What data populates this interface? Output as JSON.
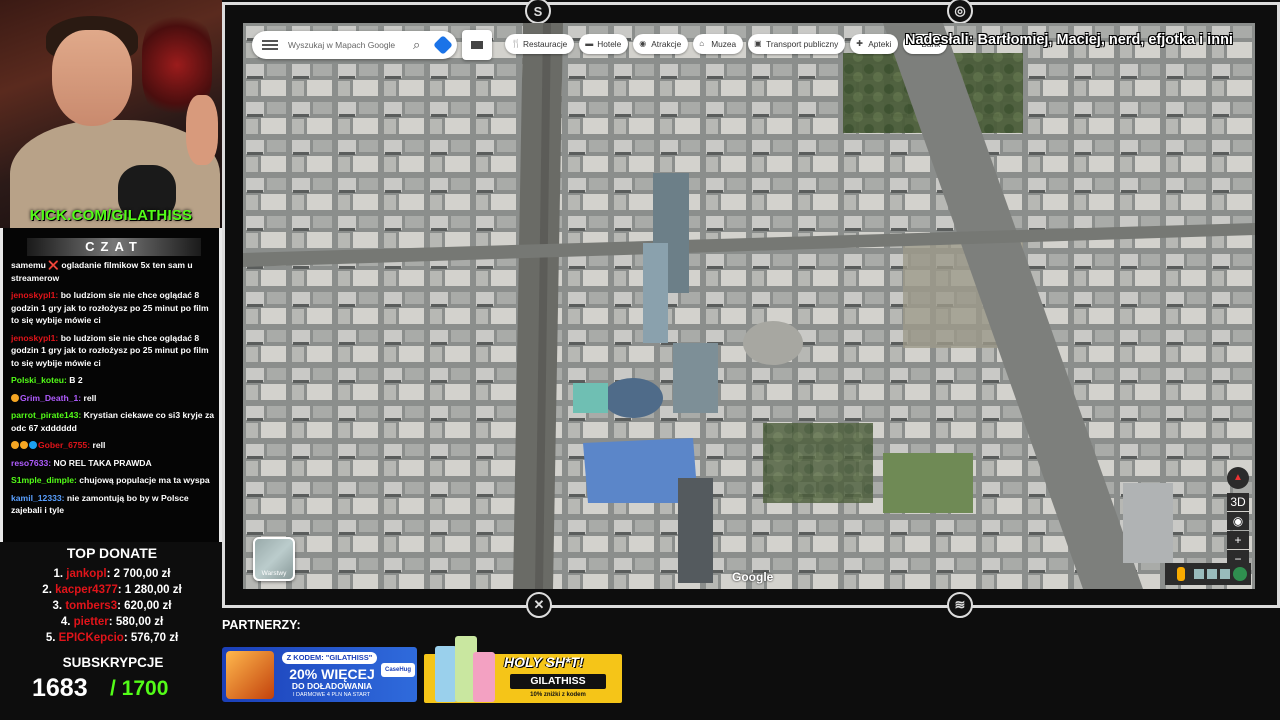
{
  "stream": {
    "kick_url": "KICK.COM/GILATHISS",
    "credits": "Nadesłali: Bartłomiej, Maciej, nerd, efjotka i inni"
  },
  "chat": {
    "title": "CZAT",
    "messages": [
      {
        "user": "",
        "user_color": "#ffffff",
        "text": "samemu ❌ ogladanie filmikow 5x ten sam u streamerow"
      },
      {
        "user": "jenoskypl1:",
        "user_color": "#e0141a",
        "text": "bo ludziom sie nie chce oglądać 8 godzin 1 gry jak to rozłożysz po 25 minut po film to się wybije mówie ci"
      },
      {
        "user": "jenoskypl1:",
        "user_color": "#e0141a",
        "text": "bo ludziom sie nie chce oglądać 8 godzin 1 gry jak to rozłożysz po 25 minut po film to się wybije mówie ci"
      },
      {
        "user": "Polski_koteu:",
        "user_color": "#53fc18",
        "text": "B 2"
      },
      {
        "user": "Grim_Death_1:",
        "user_color": "#b05cff",
        "text": "rell",
        "badges": [
          "#f5a623"
        ]
      },
      {
        "user": "parrot_pirate143:",
        "user_color": "#53fc18",
        "text": "Krystian ciekawe co si3 kryje za odc 67 xdddddd"
      },
      {
        "user": "Gober_6755:",
        "user_color": "#e0141a",
        "text": "rell",
        "badges": [
          "#f5a623",
          "#f5a623",
          "#1da1f2"
        ]
      },
      {
        "user": "reso7633:",
        "user_color": "#b05cff",
        "text": "NO REL TAKA PRAWDA"
      },
      {
        "user": "S1mple_dimple:",
        "user_color": "#53fc18",
        "text": "chujową populacje ma ta wyspa"
      },
      {
        "user": "kamil_12333:",
        "user_color": "#5aa0ff",
        "text": "nie zamontują bo by w Polsce zajebali i tyle"
      }
    ]
  },
  "top_donate": {
    "title": "TOP DONATE",
    "entries": [
      {
        "rank": "1.",
        "name": "jankopl",
        "amount": ": 2 700,00 zł"
      },
      {
        "rank": "2.",
        "name": "kacper4377",
        "amount": ": 1 280,00 zł"
      },
      {
        "rank": "3.",
        "name": "tombers3",
        "amount": ": 620,00 zł"
      },
      {
        "rank": "4.",
        "name": "pietter",
        "amount": ": 580,00 zł"
      },
      {
        "rank": "5.",
        "name": "EPICKepcio",
        "amount": ": 576,70 zł"
      }
    ]
  },
  "subs": {
    "title": "SUBSKRYPCJE",
    "count": "1683",
    "goal": "/ 1700"
  },
  "maps": {
    "search_placeholder": "Wyszukaj w Mapach Google",
    "chips": [
      {
        "label": "Restauracje",
        "icon": "fork-knife-icon",
        "glyph": "🍴"
      },
      {
        "label": "Hotele",
        "icon": "bed-icon",
        "glyph": "▬"
      },
      {
        "label": "Atrakcje",
        "icon": "camera-icon",
        "glyph": "◉"
      },
      {
        "label": "Muzea",
        "icon": "museum-icon",
        "glyph": "⌂"
      },
      {
        "label": "Transport publiczny",
        "icon": "train-icon",
        "glyph": "▣"
      },
      {
        "label": "Apteki",
        "icon": "pharmacy-icon",
        "glyph": "✚"
      },
      {
        "label": "Bank",
        "icon": "bank-icon",
        "glyph": "⋯"
      }
    ],
    "layers_label": "Warstwy",
    "google_logo": "Google"
  },
  "partners": {
    "label": "PARTNERZY:",
    "sponsor1": {
      "code_label": "Z KODEM: \"GILATHISS\"",
      "headline": "20% WIĘCEJ",
      "line2": "DO DOŁADOWANIA",
      "line3": "I DARMOWE 4 PLN NA START",
      "brand": "CaseHug"
    },
    "sponsor2": {
      "title": "HOLY SH*T!",
      "code": "GILATHISS",
      "sub": "10% zniżki z kodem"
    }
  }
}
